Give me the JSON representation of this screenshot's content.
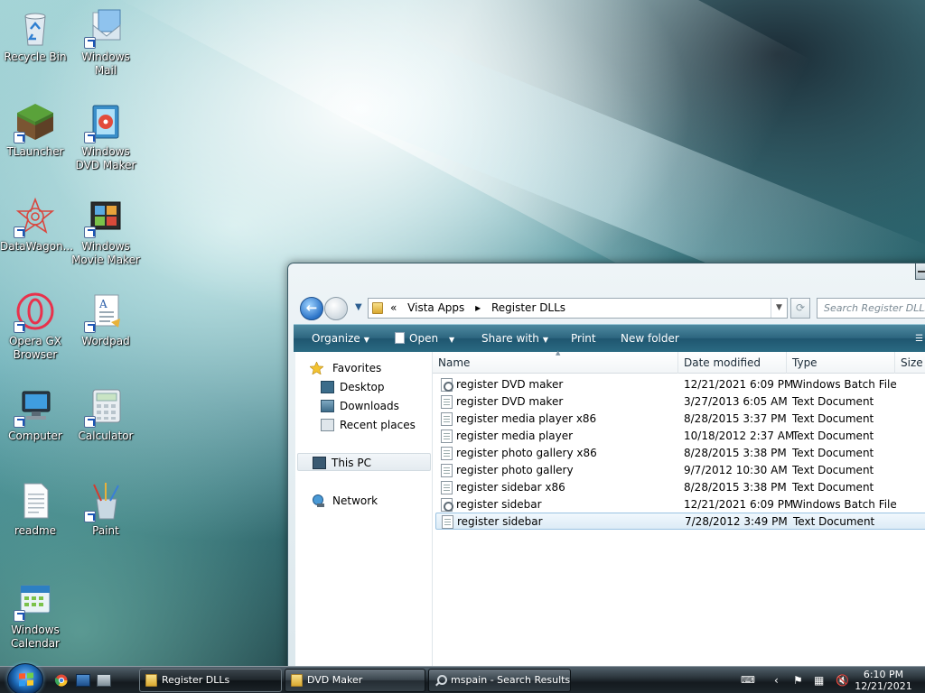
{
  "desktop": {
    "icons": [
      {
        "label": "Recycle Bin",
        "icon": "recycle-bin-icon"
      },
      {
        "label": "Windows Mail",
        "icon": "windows-mail-icon"
      },
      {
        "label": "TLauncher",
        "icon": "tlauncher-icon"
      },
      {
        "label": "Windows DVD Maker",
        "icon": "dvd-maker-icon"
      },
      {
        "label": "DataWagon...",
        "icon": "datawagon-icon"
      },
      {
        "label": "Windows Movie Maker",
        "icon": "movie-maker-icon"
      },
      {
        "label": "Opera GX Browser",
        "icon": "opera-gx-icon"
      },
      {
        "label": "Wordpad",
        "icon": "wordpad-icon"
      },
      {
        "label": "Computer",
        "icon": "computer-icon"
      },
      {
        "label": "Calculator",
        "icon": "calculator-icon"
      },
      {
        "label": "readme",
        "icon": "text-file-icon"
      },
      {
        "label": "Paint",
        "icon": "paint-icon"
      },
      {
        "label": "Windows Calendar",
        "icon": "calendar-icon"
      }
    ]
  },
  "explorer": {
    "breadcrumb": {
      "overflow": "«",
      "items": [
        "Vista Apps",
        "Register DLLs"
      ]
    },
    "search_placeholder": "Search Register DLLs",
    "toolbar": {
      "organize": "Organize",
      "open": "Open",
      "share_with": "Share with",
      "print": "Print",
      "new_folder": "New folder"
    },
    "nav": {
      "favorites": "Favorites",
      "desktop": "Desktop",
      "downloads": "Downloads",
      "recent_places": "Recent places",
      "this_pc": "This PC",
      "network": "Network"
    },
    "columns": {
      "name": "Name",
      "date_modified": "Date modified",
      "type": "Type",
      "size": "Size"
    },
    "files": [
      {
        "name": "register DVD maker",
        "date": "12/21/2021 6:09 PM",
        "type": "Windows Batch File",
        "kind": "bat"
      },
      {
        "name": "register DVD maker",
        "date": "3/27/2013 6:05 AM",
        "type": "Text Document",
        "kind": "txt"
      },
      {
        "name": "register media player x86",
        "date": "8/28/2015 3:37 PM",
        "type": "Text Document",
        "kind": "txt"
      },
      {
        "name": "register media player",
        "date": "10/18/2012 2:37 AM",
        "type": "Text Document",
        "kind": "txt"
      },
      {
        "name": "register photo gallery x86",
        "date": "8/28/2015 3:38 PM",
        "type": "Text Document",
        "kind": "txt"
      },
      {
        "name": "register photo gallery",
        "date": "9/7/2012 10:30 AM",
        "type": "Text Document",
        "kind": "txt"
      },
      {
        "name": "register sidebar x86",
        "date": "8/28/2015 3:38 PM",
        "type": "Text Document",
        "kind": "txt"
      },
      {
        "name": "register sidebar",
        "date": "12/21/2021 6:09 PM",
        "type": "Windows Batch File",
        "kind": "bat"
      },
      {
        "name": "register sidebar",
        "date": "7/28/2012 3:49 PM",
        "type": "Text Document",
        "kind": "txt",
        "selected": true
      }
    ]
  },
  "taskbar": {
    "tasks": [
      {
        "label": "Register DLLs",
        "active": true
      },
      {
        "label": "DVD Maker",
        "active": false
      },
      {
        "label": "mspain - Search Results...",
        "active": false
      }
    ],
    "clock": {
      "time": "6:10 PM",
      "date": "12/21/2021"
    }
  },
  "colors": {
    "toolbar": "#2d6680",
    "selection": "#dcebf6",
    "taskbar": "#1d252b"
  }
}
